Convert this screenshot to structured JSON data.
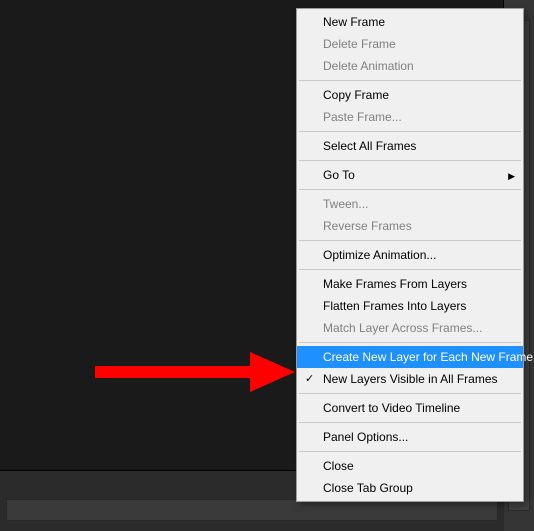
{
  "menu": {
    "items": [
      {
        "label": "New Frame",
        "enabled": true,
        "sep": false
      },
      {
        "label": "Delete Frame",
        "enabled": false,
        "sep": false
      },
      {
        "label": "Delete Animation",
        "enabled": false,
        "sep": true
      },
      {
        "label": "Copy Frame",
        "enabled": true,
        "sep": false
      },
      {
        "label": "Paste Frame...",
        "enabled": false,
        "sep": true
      },
      {
        "label": "Select All Frames",
        "enabled": true,
        "sep": true
      },
      {
        "label": "Go To",
        "enabled": true,
        "sep": true,
        "submenu": true
      },
      {
        "label": "Tween...",
        "enabled": false,
        "sep": false
      },
      {
        "label": "Reverse Frames",
        "enabled": false,
        "sep": true
      },
      {
        "label": "Optimize Animation...",
        "enabled": true,
        "sep": true
      },
      {
        "label": "Make Frames From Layers",
        "enabled": true,
        "sep": false
      },
      {
        "label": "Flatten Frames Into Layers",
        "enabled": true,
        "sep": false
      },
      {
        "label": "Match Layer Across Frames...",
        "enabled": false,
        "sep": true
      },
      {
        "label": "Create New Layer for Each New Frame",
        "enabled": true,
        "sep": false,
        "highlight": true
      },
      {
        "label": "New Layers Visible in All Frames",
        "enabled": true,
        "sep": true,
        "checked": true
      },
      {
        "label": "Convert to Video Timeline",
        "enabled": true,
        "sep": true
      },
      {
        "label": "Panel Options...",
        "enabled": true,
        "sep": true
      },
      {
        "label": "Close",
        "enabled": true,
        "sep": false
      },
      {
        "label": "Close Tab Group",
        "enabled": true,
        "sep": false
      }
    ]
  },
  "annotation": {
    "arrow_color": "#ff0000"
  }
}
